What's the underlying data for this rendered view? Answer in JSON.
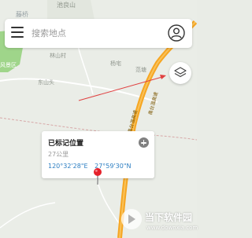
{
  "map": {
    "places": {
      "top": "池良山",
      "top_left": "藤桥",
      "linshan": "林山村",
      "yangzhai": "杨宅",
      "fanqiao": "范塘",
      "dongshan": "东山头",
      "scenic": "风景区"
    },
    "road_labels": [
      "甬台温高速",
      "甬台温高速"
    ]
  },
  "search": {
    "placeholder": "搜索地点"
  },
  "popup": {
    "title": "已标记位置",
    "distance": "27公里",
    "longitude": "120°32'28\"E",
    "latitude": "27°59'30\"N"
  },
  "icons": {
    "menu": "menu-icon",
    "user": "user-icon",
    "layers": "layers-icon",
    "add": "plus-icon",
    "marker": "pin-icon"
  },
  "colors": {
    "highway": "#f6a623",
    "popup_coords": "#2c7ec2",
    "marker": "#e5212a",
    "arrow": "#e04040"
  },
  "watermark": {
    "text": "当下软件园",
    "url": "www.downxia.com"
  }
}
